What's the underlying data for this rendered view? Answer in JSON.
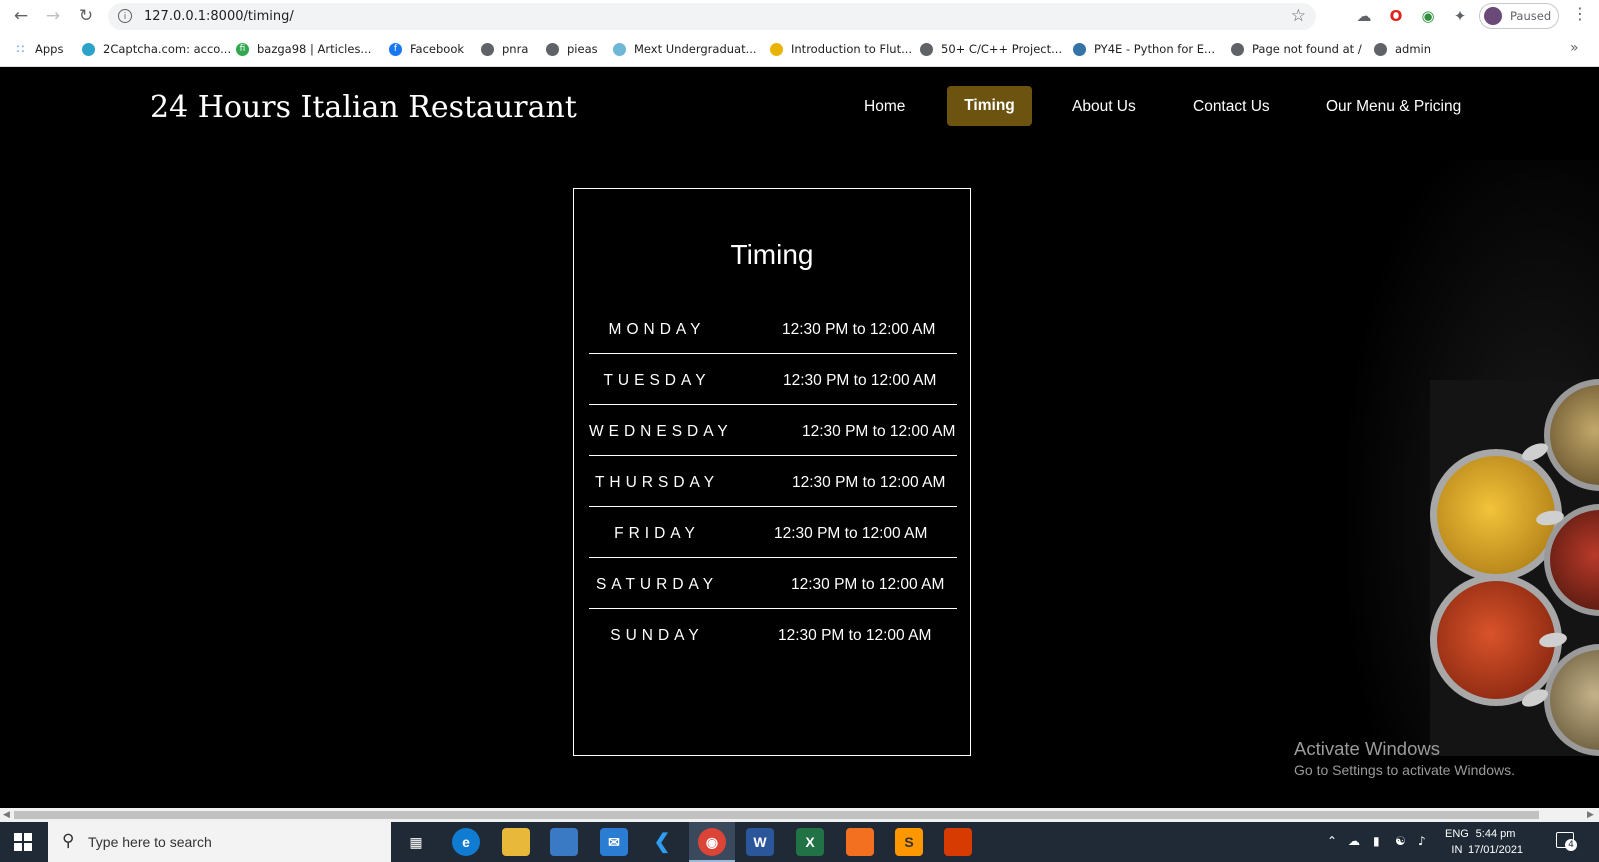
{
  "browser": {
    "url": "127.0.0.1:8000/timing/",
    "profile_status": "Paused",
    "bookmarks": [
      {
        "label": "Apps",
        "color": "#4285f4"
      },
      {
        "label": "2Captcha.com: acco...",
        "color": "#2aa2c9"
      },
      {
        "label": "bazga98 | Articles...",
        "color": "#2fa84f"
      },
      {
        "label": "Facebook",
        "color": "#1877f2"
      },
      {
        "label": "pnra",
        "color": "#5f6368"
      },
      {
        "label": "pieas",
        "color": "#5f6368"
      },
      {
        "label": "Mext Undergraduat...",
        "color": "#6fb7d6"
      },
      {
        "label": "Introduction to Flut...",
        "color": "#e8b400"
      },
      {
        "label": "50+ C/C++ Project...",
        "color": "#5f6368"
      },
      {
        "label": "PY4E - Python for E...",
        "color": "#3572a5"
      },
      {
        "label": "Page not found at /",
        "color": "#5f6368"
      },
      {
        "label": "admin",
        "color": "#5f6368"
      }
    ]
  },
  "site": {
    "title": "24 Hours Italian Restaurant",
    "nav": {
      "home": "Home",
      "timing": "Timing",
      "about": "About Us",
      "contact": "Contact Us",
      "menu": "Our Menu & Pricing"
    },
    "active_nav_color": "#6c5310"
  },
  "timing": {
    "heading": "Timing",
    "schedule": [
      {
        "day": "MONDAY",
        "hours": "12:30 PM to 12:00 AM"
      },
      {
        "day": "TUESDAY",
        "hours": "12:30 PM to 12:00 AM"
      },
      {
        "day": "WEDNESDAY",
        "hours": "12:30 PM to 12:00 AM"
      },
      {
        "day": "THURSDAY",
        "hours": "12:30 PM to 12:00 AM"
      },
      {
        "day": "FRIDAY",
        "hours": "12:30 PM to 12:00 AM"
      },
      {
        "day": "SATURDAY",
        "hours": "12:30 PM to 12:00 AM"
      },
      {
        "day": "SUNDAY",
        "hours": "12:30 PM to 12:00 AM"
      }
    ]
  },
  "watermark": {
    "line1": "Activate Windows",
    "line2": "Go to Settings to activate Windows."
  },
  "taskbar": {
    "search_placeholder": "Type here to search",
    "lang_top": "ENG",
    "lang_bottom": "IN",
    "time": "5:44 pm",
    "date": "17/01/2021",
    "notification_count": "4"
  }
}
